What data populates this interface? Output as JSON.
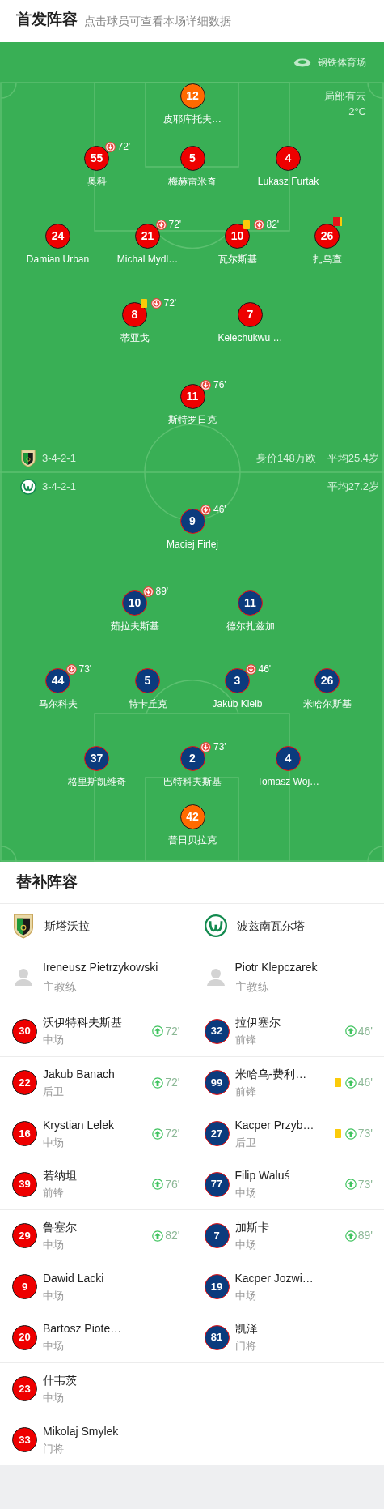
{
  "lineup_header": {
    "title": "首发阵容",
    "subtitle": "点击球员可查看本场详细数据"
  },
  "pitch": {
    "stadium": "钢铁体育场",
    "weather": "局部有云",
    "temperature": "2°C",
    "home": {
      "formation": "3-4-2-1",
      "market_value": "身价148万欧",
      "average_age": "平均25.4岁",
      "goalkeeper": {
        "number": "12",
        "name": "皮耶库托夫…"
      },
      "lines": [
        [
          {
            "number": "55",
            "name": "奥科",
            "events": [
              {
                "kind": "sub_off",
                "minute": "72'"
              }
            ]
          },
          {
            "number": "5",
            "name": "梅赫雷米奇"
          },
          {
            "number": "4",
            "name": "Lukasz Furtak"
          }
        ],
        [
          {
            "number": "24",
            "name": "Damian Urban"
          },
          {
            "number": "21",
            "name": "Michal Mydl…",
            "events": [
              {
                "kind": "sub_off",
                "minute": "72'"
              }
            ]
          },
          {
            "number": "10",
            "name": "瓦尔斯基",
            "events": [
              {
                "kind": "yellow_card"
              },
              {
                "kind": "sub_off",
                "minute": "82'"
              }
            ]
          },
          {
            "number": "26",
            "name": "扎乌查",
            "events": [
              {
                "kind": "red_card"
              }
            ]
          }
        ],
        [
          {
            "number": "8",
            "name": "蒂亚戈",
            "events": [
              {
                "kind": "yellow_card"
              },
              {
                "kind": "sub_off",
                "minute": "72'"
              }
            ]
          },
          {
            "number": "7",
            "name": "Kelechukwu …"
          }
        ],
        [
          {
            "number": "11",
            "name": "斯特罗日克",
            "events": [
              {
                "kind": "sub_off",
                "minute": "76'"
              }
            ]
          }
        ]
      ]
    },
    "away": {
      "formation": "3-4-2-1",
      "average_age": "平均27.2岁",
      "goalkeeper": {
        "number": "42",
        "name": "普日贝拉克"
      },
      "lines": [
        [
          {
            "number": "9",
            "name": "Maciej Firlej",
            "events": [
              {
                "kind": "sub_off",
                "minute": "46'"
              }
            ]
          }
        ],
        [
          {
            "number": "10",
            "name": "茹拉夫斯基",
            "events": [
              {
                "kind": "sub_off",
                "minute": "89'"
              }
            ]
          },
          {
            "number": "11",
            "name": "德尔扎兹加"
          }
        ],
        [
          {
            "number": "44",
            "name": "马尔科夫",
            "events": [
              {
                "kind": "sub_off",
                "minute": "73'"
              }
            ]
          },
          {
            "number": "5",
            "name": "特卡丘克"
          },
          {
            "number": "3",
            "name": "Jakub Kielb",
            "events": [
              {
                "kind": "sub_off",
                "minute": "46'"
              }
            ]
          },
          {
            "number": "26",
            "name": "米哈尔斯基"
          }
        ],
        [
          {
            "number": "37",
            "name": "格里斯凯维奇"
          },
          {
            "number": "2",
            "name": "巴特科夫斯基",
            "events": [
              {
                "kind": "sub_off",
                "minute": "73'"
              }
            ]
          },
          {
            "number": "4",
            "name": "Tomasz Woj…"
          }
        ]
      ]
    }
  },
  "bench_header": {
    "title": "替补阵容"
  },
  "bench": [
    {
      "team": "斯塔沃拉",
      "coach": {
        "name": "Ireneusz Pietrzykowski",
        "role": "主教练"
      },
      "players": [
        {
          "number": "30",
          "name": "沃伊特科夫斯基",
          "position": "中场",
          "events": [
            {
              "kind": "sub_on",
              "minute": "72'"
            }
          ]
        },
        {
          "number": "22",
          "name": "Jakub Banach",
          "position": "后卫",
          "events": [
            {
              "kind": "sub_on",
              "minute": "72'"
            }
          ]
        },
        {
          "number": "16",
          "name": "Krystian Lelek",
          "position": "中场",
          "events": [
            {
              "kind": "sub_on",
              "minute": "72'"
            }
          ]
        },
        {
          "number": "39",
          "name": "若纳坦",
          "position": "前锋",
          "events": [
            {
              "kind": "sub_on",
              "minute": "76'"
            }
          ]
        },
        {
          "number": "29",
          "name": "鲁塞尔",
          "position": "中场",
          "events": [
            {
              "kind": "sub_on",
              "minute": "82'"
            }
          ]
        },
        {
          "number": "9",
          "name": "Dawid Lacki",
          "position": "中场"
        },
        {
          "number": "20",
          "name": "Bartosz Piote…",
          "position": "中场"
        },
        {
          "number": "23",
          "name": "什韦茨",
          "position": "中场"
        },
        {
          "number": "33",
          "name": "Mikolaj Smylek",
          "position": "门将"
        }
      ]
    },
    {
      "team": "波兹南瓦尔塔",
      "coach": {
        "name": "Piotr Klepczarek",
        "role": "主教练"
      },
      "players": [
        {
          "number": "32",
          "name": "拉伊塞尔",
          "position": "前锋",
          "events": [
            {
              "kind": "sub_on",
              "minute": "46'"
            }
          ]
        },
        {
          "number": "99",
          "name": "米哈乌-费利…",
          "position": "前锋",
          "events": [
            {
              "kind": "yellow_card"
            },
            {
              "kind": "sub_on",
              "minute": "46'"
            }
          ]
        },
        {
          "number": "27",
          "name": "Kacper Przyb…",
          "position": "后卫",
          "events": [
            {
              "kind": "yellow_card"
            },
            {
              "kind": "sub_on",
              "minute": "73'"
            }
          ]
        },
        {
          "number": "77",
          "name": "Filip Waluś",
          "position": "中场",
          "events": [
            {
              "kind": "sub_on",
              "minute": "73'"
            }
          ]
        },
        {
          "number": "7",
          "name": "加斯卡",
          "position": "中场",
          "events": [
            {
              "kind": "sub_on",
              "minute": "89'"
            }
          ]
        },
        {
          "number": "19",
          "name": "Kacper Jozwi…",
          "position": "中场"
        },
        {
          "number": "81",
          "name": "凯泽",
          "position": "门将"
        }
      ]
    }
  ]
}
